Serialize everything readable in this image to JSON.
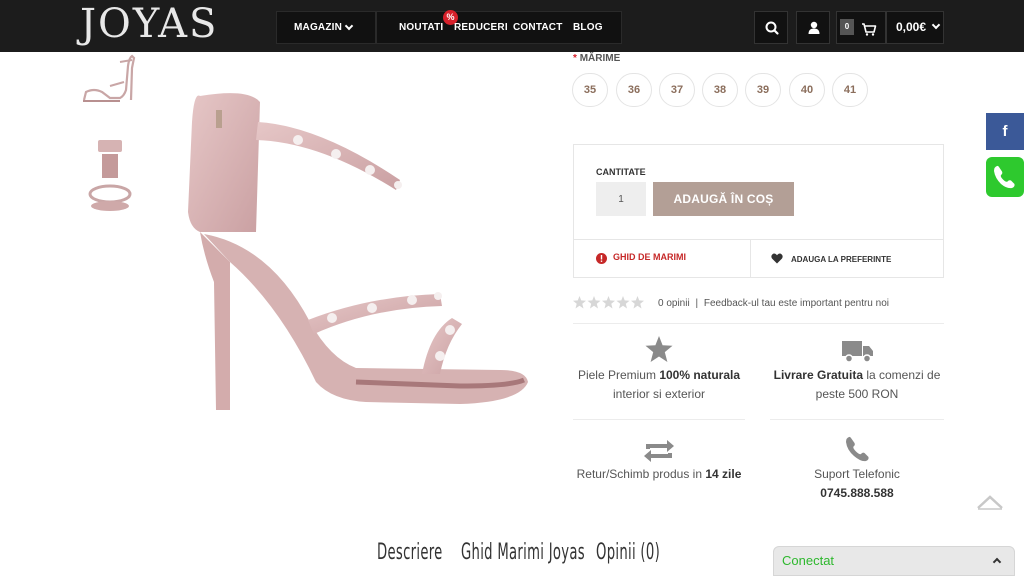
{
  "header": {
    "logo": "JOYAS",
    "nav": {
      "magazin": "MAGAZIN",
      "noutati": "NOUTATI",
      "reduceri": "REDUCERI",
      "reduceri_badge": "%",
      "contact": "CONTACT",
      "blog": "BLOG"
    },
    "cart_count": "0",
    "cart_total": "0,00€",
    "icons": [
      "search-icon",
      "user-icon",
      "cart-icon",
      "chevron-down-icon"
    ]
  },
  "product": {
    "size_required_mark": "*",
    "size_label": "MĂRIME",
    "sizes": [
      "35",
      "36",
      "37",
      "38",
      "39",
      "40",
      "41"
    ],
    "quantity_label": "CANTITATE",
    "quantity_value": "1",
    "add_to_cart": "ADAUGĂ ÎN COȘ",
    "size_guide": "GHID DE MARIMI",
    "add_favorite": "ADAUGA LA PREFERINTE",
    "rating_stars": 0,
    "reviews_count": "0 opinii",
    "reviews_sep": "|",
    "feedback": "Feedback-ul tau este important pentru noi",
    "product_color": "#d9b5b5"
  },
  "features": [
    {
      "icon": "star-icon",
      "pre": "Piele Premium ",
      "bold": "100% naturala",
      "post": " interior si exterior"
    },
    {
      "icon": "truck-icon",
      "bold": "Livrare Gratuita",
      "post": " la comenzi de peste 500 RON"
    },
    {
      "icon": "exchange-icon",
      "pre": "Retur/Schimb produs in ",
      "bold": "14 zile"
    },
    {
      "icon": "phone-icon",
      "pre": "Suport Telefonic",
      "bold": "0745.888.588"
    }
  ],
  "tabs": [
    "Descriere",
    "Ghid Marimi Joyas",
    "Opinii (0)"
  ],
  "social": {
    "facebook": "f"
  },
  "chat": {
    "label": "Conectat"
  },
  "colors": {
    "header_bg": "#1c1c1c",
    "accent_button": "#b39f96",
    "size_text": "#8b6e5c",
    "danger": "#c62828",
    "chat_online": "#2eb82e"
  }
}
